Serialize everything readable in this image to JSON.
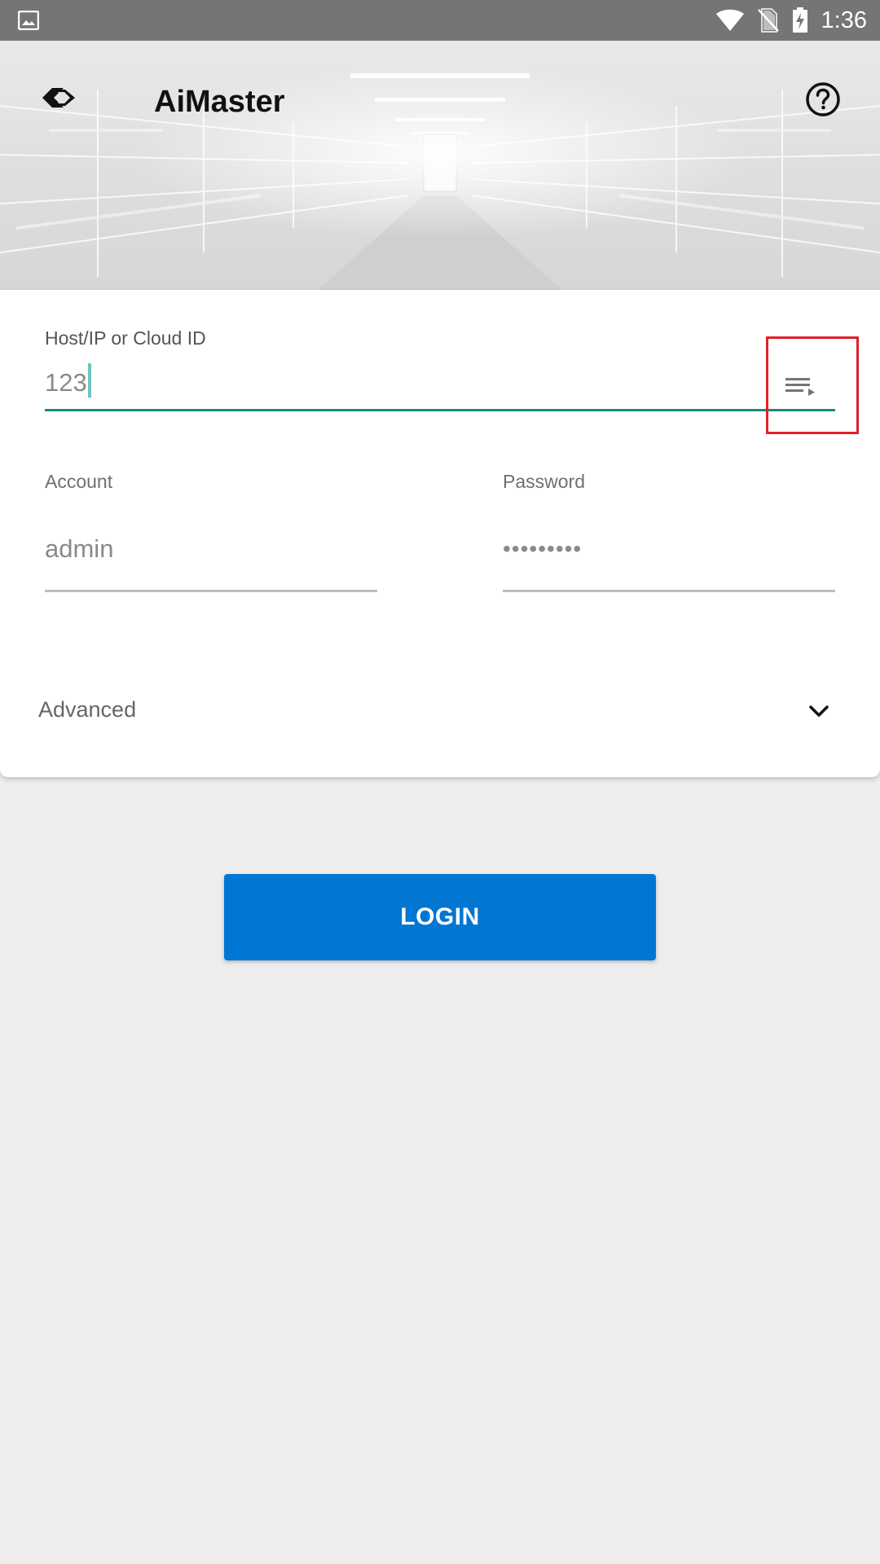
{
  "status_bar": {
    "time": "1:36",
    "icons": [
      "gallery-icon",
      "wifi-icon",
      "no-sim-icon",
      "battery-charging-icon"
    ]
  },
  "header": {
    "title": "AiMaster",
    "icons": [
      "app-logo-icon",
      "help-icon"
    ]
  },
  "form": {
    "host": {
      "label": "Host/IP or Cloud ID",
      "value": "123",
      "history_icon": "history-list-icon"
    },
    "account": {
      "label": "Account",
      "value": "admin"
    },
    "password": {
      "label": "Password",
      "value": "•••••••••"
    },
    "advanced": {
      "label": "Advanced",
      "icon": "chevron-down-icon"
    }
  },
  "login": {
    "label": "LOGIN"
  },
  "colors": {
    "accent_focus": "#1a8a7f",
    "primary_button": "#0176d3",
    "highlight_box": "#e0202a",
    "status_bar": "#757575",
    "page_background": "#ededee"
  }
}
